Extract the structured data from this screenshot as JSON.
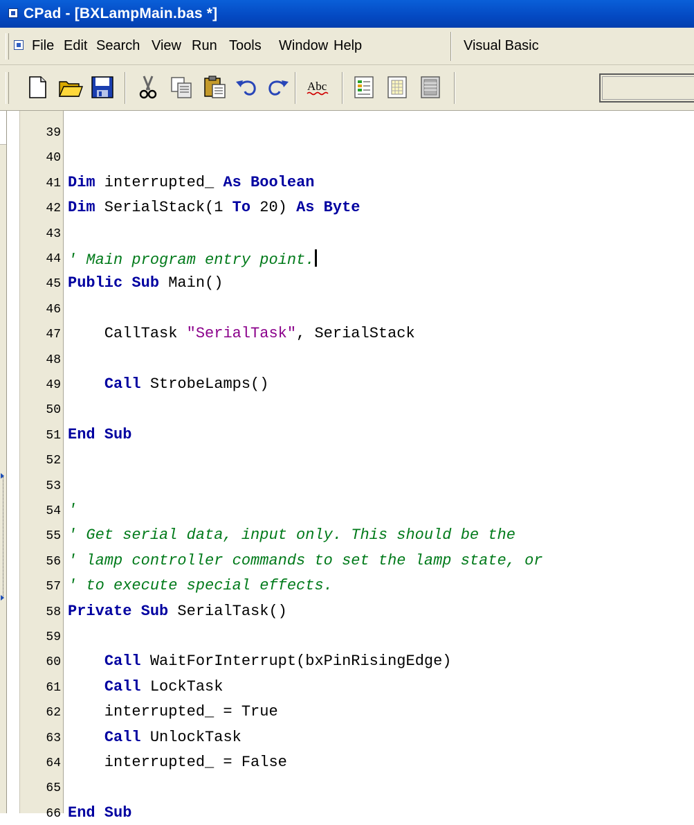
{
  "window": {
    "title": "CPad - [BXLampMain.bas *]"
  },
  "menu": {
    "items": [
      "File",
      "Edit",
      "Search",
      "View",
      "Run",
      "Tools",
      "Window",
      "Help",
      "Visual Basic"
    ]
  },
  "toolbar": {
    "buttons": [
      "new-file-icon",
      "open-folder-icon",
      "save-icon",
      "cut-icon",
      "copy-icon",
      "paste-icon",
      "undo-icon",
      "redo-icon",
      "spell-check-icon",
      "doc-colored-icon",
      "doc-grid-icon",
      "doc-gray-icon"
    ],
    "spell_label": "Abc"
  },
  "editor": {
    "caret_line": 44,
    "lines": [
      {
        "num": "39",
        "tokens": []
      },
      {
        "num": "40",
        "tokens": []
      },
      {
        "num": "41",
        "tokens": [
          [
            "kw",
            "Dim"
          ],
          [
            "t",
            " interrupted_ "
          ],
          [
            "kw",
            "As Boolean"
          ]
        ]
      },
      {
        "num": "42",
        "tokens": [
          [
            "kw",
            "Dim"
          ],
          [
            "t",
            " SerialStack(1 "
          ],
          [
            "kw",
            "To"
          ],
          [
            "t",
            " 20) "
          ],
          [
            "kw",
            "As Byte"
          ]
        ]
      },
      {
        "num": "43",
        "tokens": []
      },
      {
        "num": "44",
        "tokens": [
          [
            "cm",
            "' Main program entry point."
          ]
        ]
      },
      {
        "num": "45",
        "tokens": [
          [
            "kw",
            "Public Sub"
          ],
          [
            "t",
            " Main()"
          ]
        ]
      },
      {
        "num": "46",
        "tokens": []
      },
      {
        "num": "47",
        "tokens": [
          [
            "t",
            "    CallTask "
          ],
          [
            "st",
            "\"SerialTask\""
          ],
          [
            "t",
            ", SerialStack"
          ]
        ]
      },
      {
        "num": "48",
        "tokens": []
      },
      {
        "num": "49",
        "tokens": [
          [
            "t",
            "    "
          ],
          [
            "kw",
            "Call"
          ],
          [
            "t",
            " StrobeLamps()"
          ]
        ]
      },
      {
        "num": "50",
        "tokens": []
      },
      {
        "num": "51",
        "tokens": [
          [
            "kw",
            "End Sub"
          ]
        ]
      },
      {
        "num": "52",
        "tokens": []
      },
      {
        "num": "53",
        "tokens": []
      },
      {
        "num": "54",
        "tokens": [
          [
            "cm",
            "'"
          ]
        ]
      },
      {
        "num": "55",
        "tokens": [
          [
            "cm",
            "' Get serial data, input only. This should be the"
          ]
        ]
      },
      {
        "num": "56",
        "tokens": [
          [
            "cm",
            "' lamp controller commands to set the lamp state, or"
          ]
        ]
      },
      {
        "num": "57",
        "tokens": [
          [
            "cm",
            "' to execute special effects."
          ]
        ]
      },
      {
        "num": "58",
        "tokens": [
          [
            "kw",
            "Private Sub"
          ],
          [
            "t",
            " SerialTask()"
          ]
        ]
      },
      {
        "num": "59",
        "tokens": []
      },
      {
        "num": "60",
        "tokens": [
          [
            "t",
            "    "
          ],
          [
            "kw",
            "Call"
          ],
          [
            "t",
            " WaitForInterrupt(bxPinRisingEdge)"
          ]
        ]
      },
      {
        "num": "61",
        "tokens": [
          [
            "t",
            "    "
          ],
          [
            "kw",
            "Call"
          ],
          [
            "t",
            " LockTask"
          ]
        ]
      },
      {
        "num": "62",
        "tokens": [
          [
            "t",
            "    interrupted_ = True"
          ]
        ]
      },
      {
        "num": "63",
        "tokens": [
          [
            "t",
            "    "
          ],
          [
            "kw",
            "Call"
          ],
          [
            "t",
            " UnlockTask"
          ]
        ]
      },
      {
        "num": "64",
        "tokens": [
          [
            "t",
            "    interrupted_ = False"
          ]
        ]
      },
      {
        "num": "65",
        "tokens": []
      },
      {
        "num": "66",
        "tokens": [
          [
            "kw",
            "End Sub"
          ]
        ]
      }
    ]
  }
}
